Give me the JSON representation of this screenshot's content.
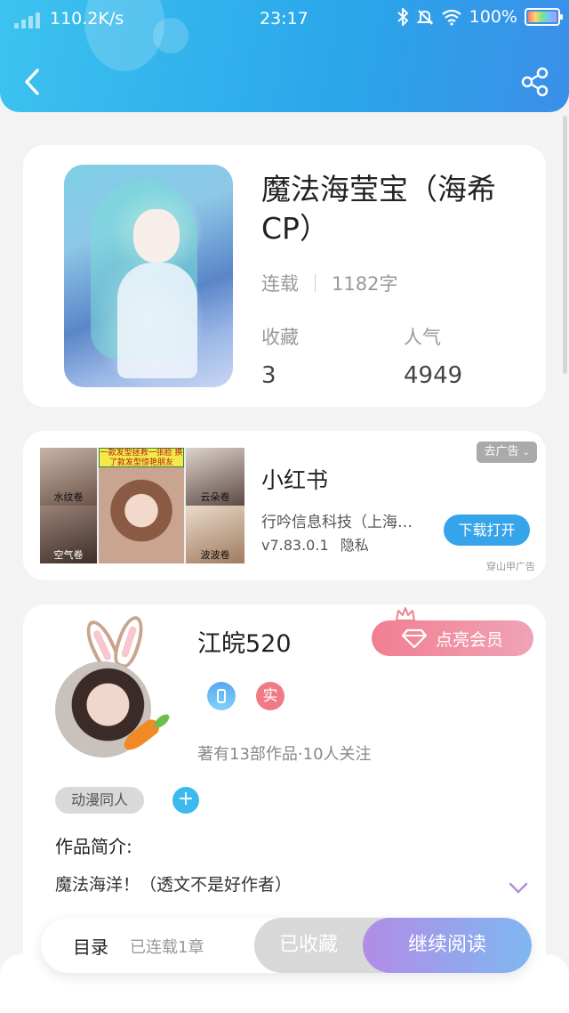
{
  "status_bar": {
    "network_speed": "110.2K/s",
    "time": "23:17",
    "battery": "100%",
    "icons": [
      "signal-icon",
      "bluetooth-icon",
      "mute-icon",
      "wifi-icon",
      "battery-icon"
    ]
  },
  "header": {
    "back_icon": "back-arrow-icon",
    "share_icon": "share-icon",
    "accent_color": "#2aa6ea"
  },
  "book": {
    "title": "魔法海莹宝（海希CP）",
    "status": "连载",
    "word_count": "1182字",
    "favorites_label": "收藏",
    "favorites_value": "3",
    "popularity_label": "人气",
    "popularity_value": "4949"
  },
  "ad": {
    "app_name": "小红书",
    "company": "行吟信息科技（上海…",
    "version": "v7.83.0.1",
    "privacy": "隐私",
    "remove_ad": "去广告",
    "download": "下载打开",
    "source": "穿山甲广告",
    "banner_text": "一款发型拯救一张脸 换了款发型惊艳朋友",
    "tiles": [
      "水纹卷",
      "云朵卷",
      "空气卷",
      "波波卷"
    ]
  },
  "author": {
    "name": "江皖520",
    "vip_button": "点亮会员",
    "verified_badge": "实",
    "stats": "著有13部作品·10人关注",
    "tag": "动漫同人",
    "intro_label": "作品简介:",
    "intro_text": "魔法海洋！（透文不是好作者）"
  },
  "bottom_bar": {
    "toc": "目录",
    "serial": "已连载1章",
    "collected": "已收藏",
    "continue_reading": "继续阅读"
  }
}
